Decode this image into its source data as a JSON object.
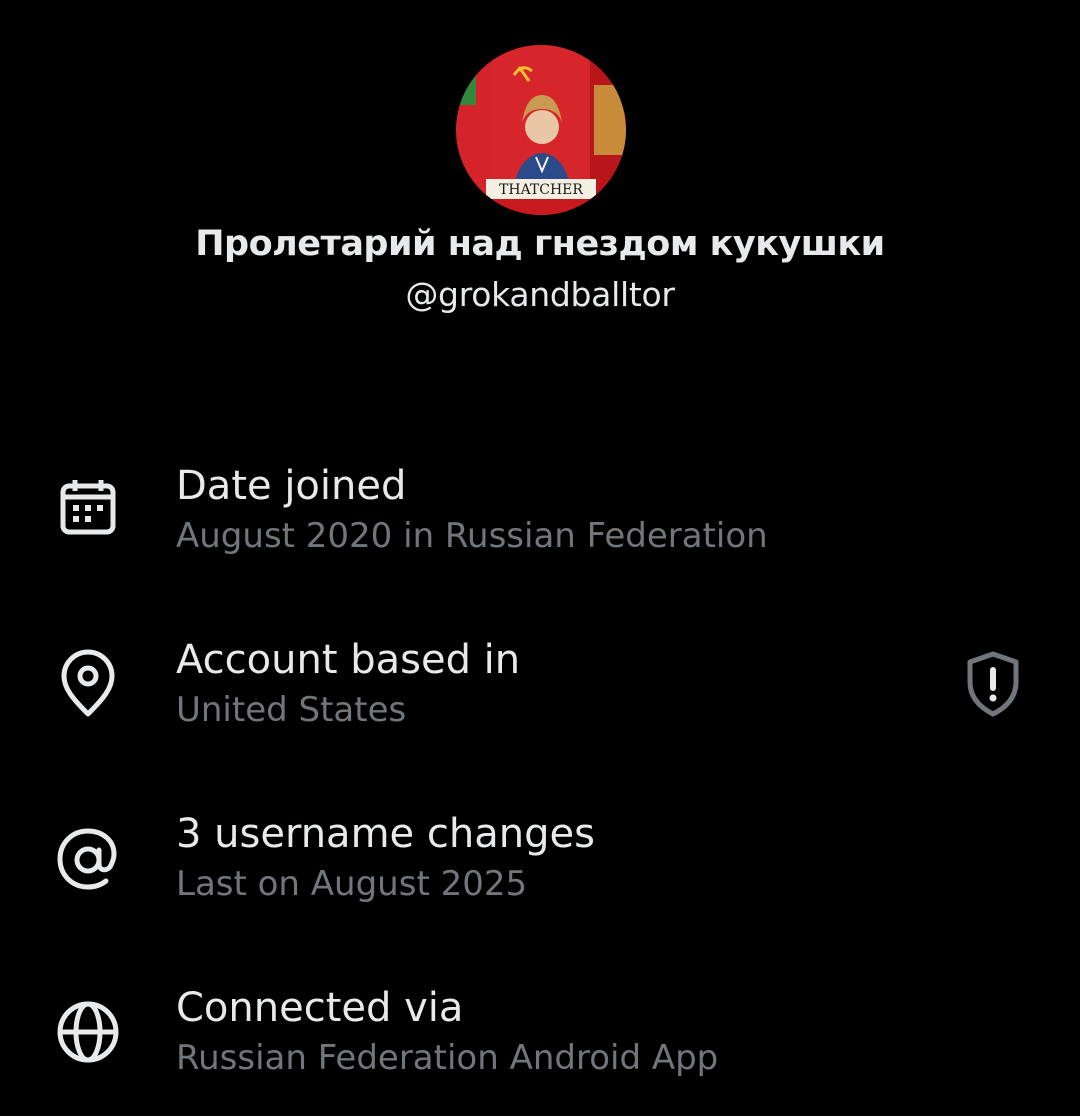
{
  "profile": {
    "display_name": "Пролетарий над гнездом кукушки",
    "handle": "@grokandballtor",
    "avatar": {
      "icon": "profile-avatar",
      "caption": "THATCHER"
    }
  },
  "about": {
    "items": [
      {
        "icon": "calendar-icon",
        "title": "Date joined",
        "subtitle": "August 2020 in Russian Federation"
      },
      {
        "icon": "location-pin-icon",
        "title": "Account based in",
        "subtitle": "United States",
        "trailing_icon": "shield-alert-icon"
      },
      {
        "icon": "at-sign-icon",
        "title": "3 username changes",
        "subtitle": "Last on August 2025"
      },
      {
        "icon": "globe-icon",
        "title": "Connected via",
        "subtitle": "Russian Federation Android App"
      }
    ]
  },
  "colors": {
    "background": "#000000",
    "primary_text": "#e7e9ea",
    "secondary_text": "#71767b",
    "icon": "#e7e9ea",
    "shield_icon": "#71767b"
  }
}
